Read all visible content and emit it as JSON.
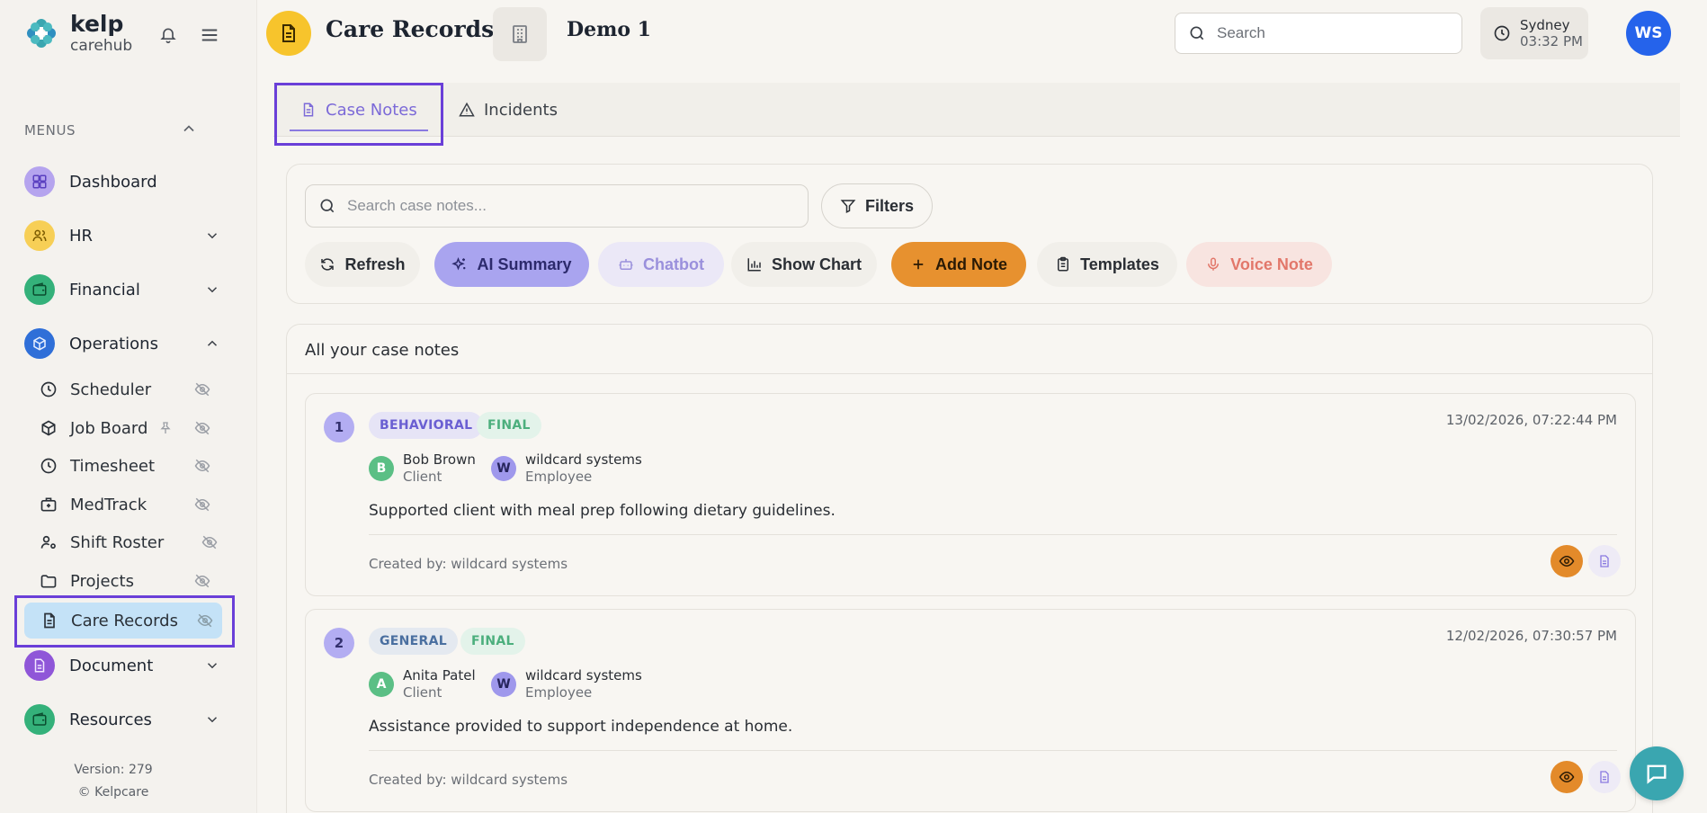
{
  "app": {
    "name": "kelp",
    "sub": "carehub"
  },
  "sidebar": {
    "menus_label": "MENUS",
    "items": [
      {
        "label": "Dashboard"
      },
      {
        "label": "HR"
      },
      {
        "label": "Financial"
      },
      {
        "label": "Operations"
      }
    ],
    "sub_items": [
      {
        "label": "Scheduler"
      },
      {
        "label": "Job Board"
      },
      {
        "label": "Timesheet"
      },
      {
        "label": "MedTrack"
      },
      {
        "label": "Shift Roster"
      },
      {
        "label": "Projects"
      },
      {
        "label": "Care Records"
      }
    ],
    "bottom_items": [
      {
        "label": "Document"
      },
      {
        "label": "Resources"
      }
    ],
    "version": "Version: 279",
    "copyright": "© Kelpcare"
  },
  "header": {
    "title": "Care Records",
    "org": "Demo 1",
    "search_placeholder": "Search",
    "clock_city": "Sydney",
    "clock_time": "03:32 PM",
    "avatar": "WS"
  },
  "tabs": [
    {
      "label": "Case Notes"
    },
    {
      "label": "Incidents"
    }
  ],
  "toolbar": {
    "search_placeholder": "Search case notes...",
    "filters": "Filters",
    "refresh": "Refresh",
    "ai_summary": "AI Summary",
    "chatbot": "Chatbot",
    "show_chart": "Show Chart",
    "add_note": "Add Note",
    "templates": "Templates",
    "voice_note": "Voice Note"
  },
  "list": {
    "title": "All your case notes",
    "notes": [
      {
        "num": "1",
        "category": "BEHAVIORAL",
        "status": "FINAL",
        "date": "13/02/2026, 07:22:44 PM",
        "client_initial": "B",
        "client_name": "Bob Brown",
        "client_role": "Client",
        "employee_initial": "W",
        "employee_name": "wildcard systems",
        "employee_role": "Employee",
        "text": "Supported client with meal prep following dietary guidelines.",
        "created_by": "Created by: wildcard systems"
      },
      {
        "num": "2",
        "category": "GENERAL",
        "status": "FINAL",
        "date": "12/02/2026, 07:30:57 PM",
        "client_initial": "A",
        "client_name": "Anita Patel",
        "client_role": "Client",
        "employee_initial": "W",
        "employee_name": "wildcard systems",
        "employee_role": "Employee",
        "text": "Assistance provided to support independence at home.",
        "created_by": "Created by: wildcard systems"
      }
    ]
  },
  "colors": {
    "accent": "#7c6ad8",
    "highlight": "#6a3fd8",
    "add_note": "#e7912f",
    "active_nav": "#c4e2f7"
  }
}
